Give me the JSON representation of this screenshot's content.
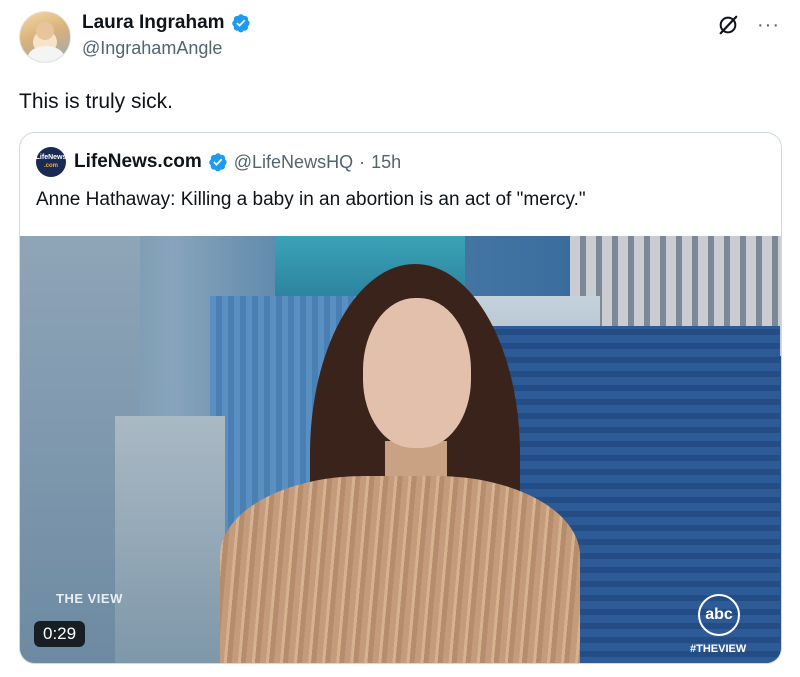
{
  "author": {
    "name": "Laura Ingraham",
    "handle": "@IngrahamAngle"
  },
  "tweet": {
    "text": "This is truly sick."
  },
  "actions": {
    "more": "···"
  },
  "quote": {
    "logo_top": "LifeNews",
    "logo_bottom": ".com",
    "name": "LifeNews.com",
    "handle": "@LifeNewsHQ",
    "separator": "·",
    "time": "15h",
    "text": "Anne Hathaway: Killing a baby in an abortion is an act of \"mercy.\""
  },
  "video": {
    "show_logo": "THE VIEW",
    "duration": "0:29",
    "network": "abc",
    "hashtag": "#THEVIEW"
  },
  "colors": {
    "verified": "#1d9bf0",
    "secondary_text": "#536471",
    "border": "#cfd9de"
  }
}
